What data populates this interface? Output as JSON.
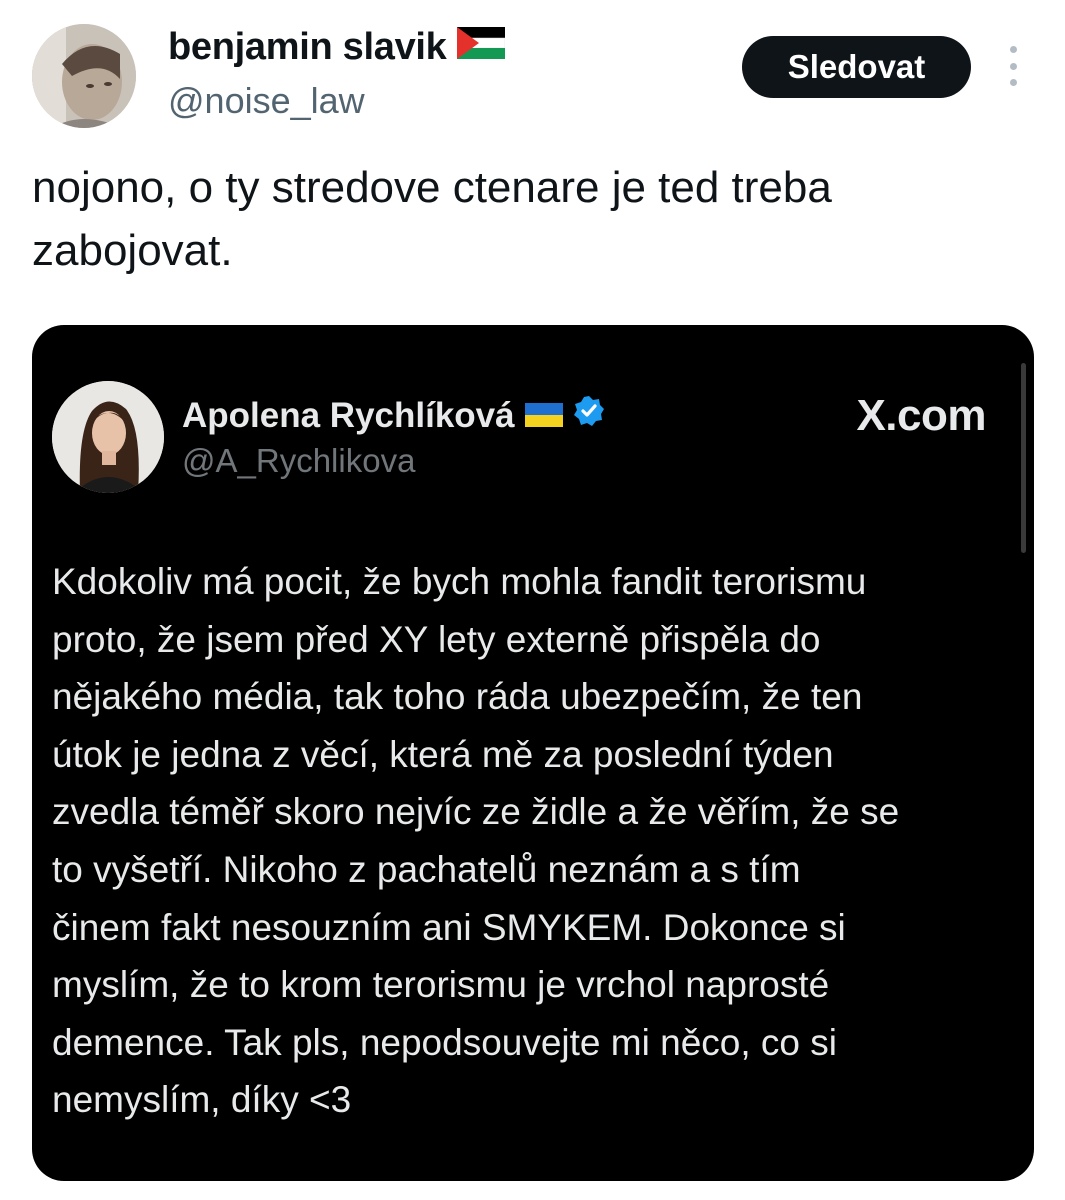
{
  "post": {
    "author": {
      "display_name": "benjamin slavik",
      "flag_icon": "palestine-flag-icon",
      "handle": "@noise_law"
    },
    "follow_label": "Sledovat",
    "text": "nojono, o ty stredove ctenare je ted treba\nzabojovat."
  },
  "embedded": {
    "author": {
      "display_name": "Apolena Rychlíková",
      "flag_icon": "ukraine-flag-icon",
      "verified_icon": "verified-badge-icon",
      "handle": "@A_Rychlikova"
    },
    "source_label": "X.com",
    "text": "Kdokoliv má pocit, že bych mohla fandit terorismu\nproto, že jsem před XY lety externě přispěla do\nnějakého média, tak toho ráda ubezpečím, že ten\nútok je jedna z věcí, která mě za poslední týden\nzvedla téměř skoro nejvíc ze židle a že věřím, že se\nto vyšetří. Nikoho z pachatelů neznám a s tím\nčinem fakt nesouzním ani SMYKEM. Dokonce si\nmyslím, že to krom terorismu je vrchol naprosté\ndemence. Tak pls, nepodsouvejte mi něco, co si\nnemyslím, díky <3"
  },
  "colors": {
    "text_primary": "#0f1419",
    "text_secondary": "#536471",
    "follow_button_bg": "#0f1419",
    "card_bg": "#000000",
    "card_text": "#e7e9ea",
    "card_handle": "#71767b",
    "verified_blue": "#1d9bf0"
  }
}
